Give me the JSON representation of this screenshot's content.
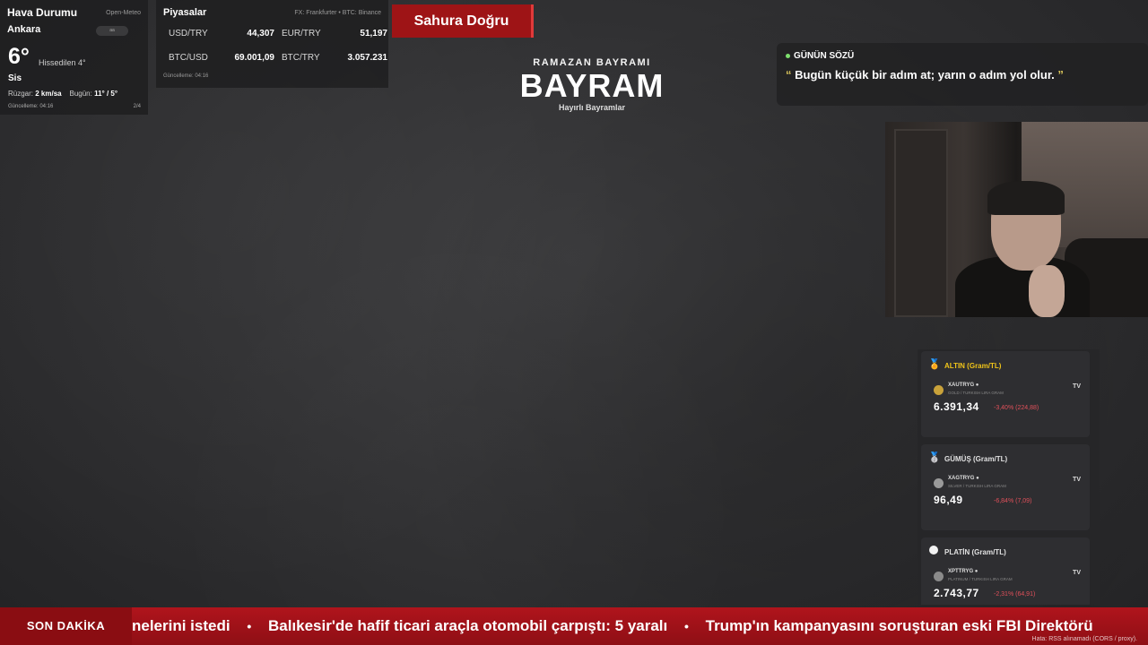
{
  "weather": {
    "title": "Hava Durumu",
    "source": "Open-Meteo",
    "city": "Ankara",
    "badge": "aa",
    "temperature": "6°",
    "feels_like": "Hissedilen 4°",
    "condition": "Sis",
    "wind_label": "Rüzgar:",
    "wind_value": "2 km/sa",
    "today_label": "Bugün:",
    "today_value": "11° / 5°",
    "updated": "Güncelleme: 04:16",
    "page": "2/4"
  },
  "markets": {
    "title": "Piyasalar",
    "source": "FX: Frankfurter • BTC: Binance",
    "rows": [
      {
        "label": "USD/TRY",
        "value": "44,307"
      },
      {
        "label": "EUR/TRY",
        "value": "51,197"
      },
      {
        "label": "BTC/USD",
        "value": "69.001,09"
      },
      {
        "label": "BTC/TRY",
        "value": "3.057.231"
      }
    ],
    "updated": "Güncelleme: 04:16"
  },
  "sahur": {
    "label": "Sahura Doğru"
  },
  "center": {
    "subtitle": "RAMAZAN BAYRAMI",
    "title": "BAYRAM",
    "tagline": "Hayırlı Bayramlar"
  },
  "quote": {
    "heading": "GÜNÜN SÖZÜ",
    "open_mark": "“",
    "text": "Bugün küçük bir adım at; yarın o adım yol olur.",
    "close_mark": "”"
  },
  "commodities": [
    {
      "title": "ALTIN (Gram/TL)",
      "icon": "medal-icon",
      "symbol": "XAUTRYG ●",
      "desc": "GOLD / TURKISH LIRA GRAM",
      "price": "6.391,34",
      "change": "-3,40% (224,88)",
      "title_color": "#f0c419",
      "coin_color": "#c9a23a"
    },
    {
      "title": "GÜMÜŞ (Gram/TL)",
      "icon": "medal-icon",
      "symbol": "XAGTRYG ●",
      "desc": "SILVER / TURKISH LIRA GRAM",
      "price": "96,49",
      "change": "-6,84% (7,09)",
      "title_color": "#e0e0e0",
      "coin_color": "#9a9a9a"
    },
    {
      "title": "PLATİN (Gram/TL)",
      "icon": "circle-icon",
      "symbol": "XPTTRYG ●",
      "desc": "PLATINUM / TURKISH LIRA GRAM",
      "price": "2.743,77",
      "change": "-2,31% (64,91)",
      "title_color": "#e0e0e0",
      "coin_color": "#8a8a8a"
    }
  ],
  "commodity_tv_label": "TV",
  "ticker": {
    "label": "SON DAKİKA",
    "items": [
      "nelerini istedi",
      "Balıkesir'de hafif ticari araçla otomobil çarpıştı: 5 yaralı",
      "Trump'ın kampanyasını soruşturan eski FBI Direktörü"
    ],
    "separator": "•",
    "error": "Hata: RSS alınamadı (CORS / proxy)."
  }
}
